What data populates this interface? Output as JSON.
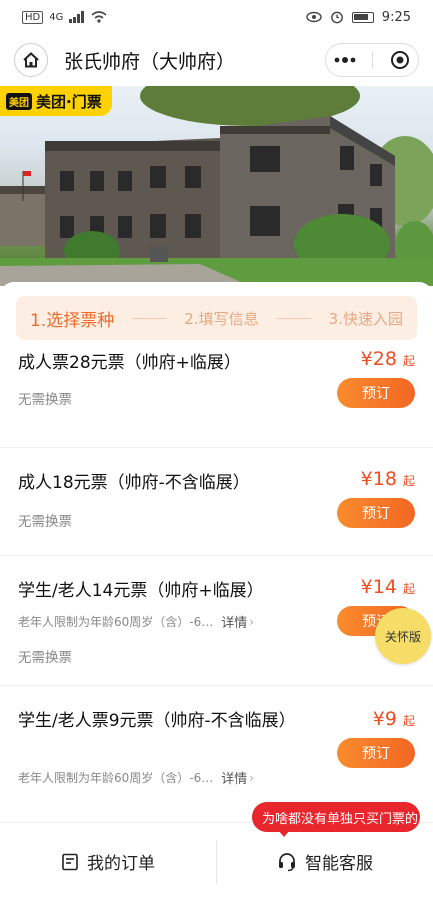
{
  "status_bar": {
    "left": "HD",
    "signal": "4G",
    "time": "9:25"
  },
  "header": {
    "title": "张氏帅府（大帅府）"
  },
  "banner": {
    "logo_badge": "美团",
    "brand": "美团·门票"
  },
  "steps": [
    {
      "label": "1.选择票种"
    },
    {
      "label": "2.填写信息"
    },
    {
      "label": "3.快速入园"
    }
  ],
  "tickets": [
    {
      "name": "成人票28元票（帅府+临展）",
      "note": "无需换票",
      "price": "¥28",
      "suffix": "起",
      "button": "预订"
    },
    {
      "name": "成人18元票（帅府-不含临展）",
      "note": "无需换票",
      "price": "¥18",
      "suffix": "起",
      "button": "预订"
    },
    {
      "name": "学生/老人14元票（帅府+临展）",
      "limit": "老年人限制为年龄60周岁（含）-6…",
      "detail": "详情",
      "note": "无需换票",
      "price": "¥14",
      "suffix": "起",
      "button": "预订"
    },
    {
      "name": "学生/老人票9元票（帅府-不含临展）",
      "limit": "老年人限制为年龄60周岁（含）-6…",
      "detail": "详情",
      "price": "¥9",
      "suffix": "起",
      "button": "预订"
    }
  ],
  "care_badge": "关怀版",
  "bubble": "为啥都没有单独只买门票的",
  "bottom_bar": {
    "orders": "我的订单",
    "service": "智能客服"
  }
}
